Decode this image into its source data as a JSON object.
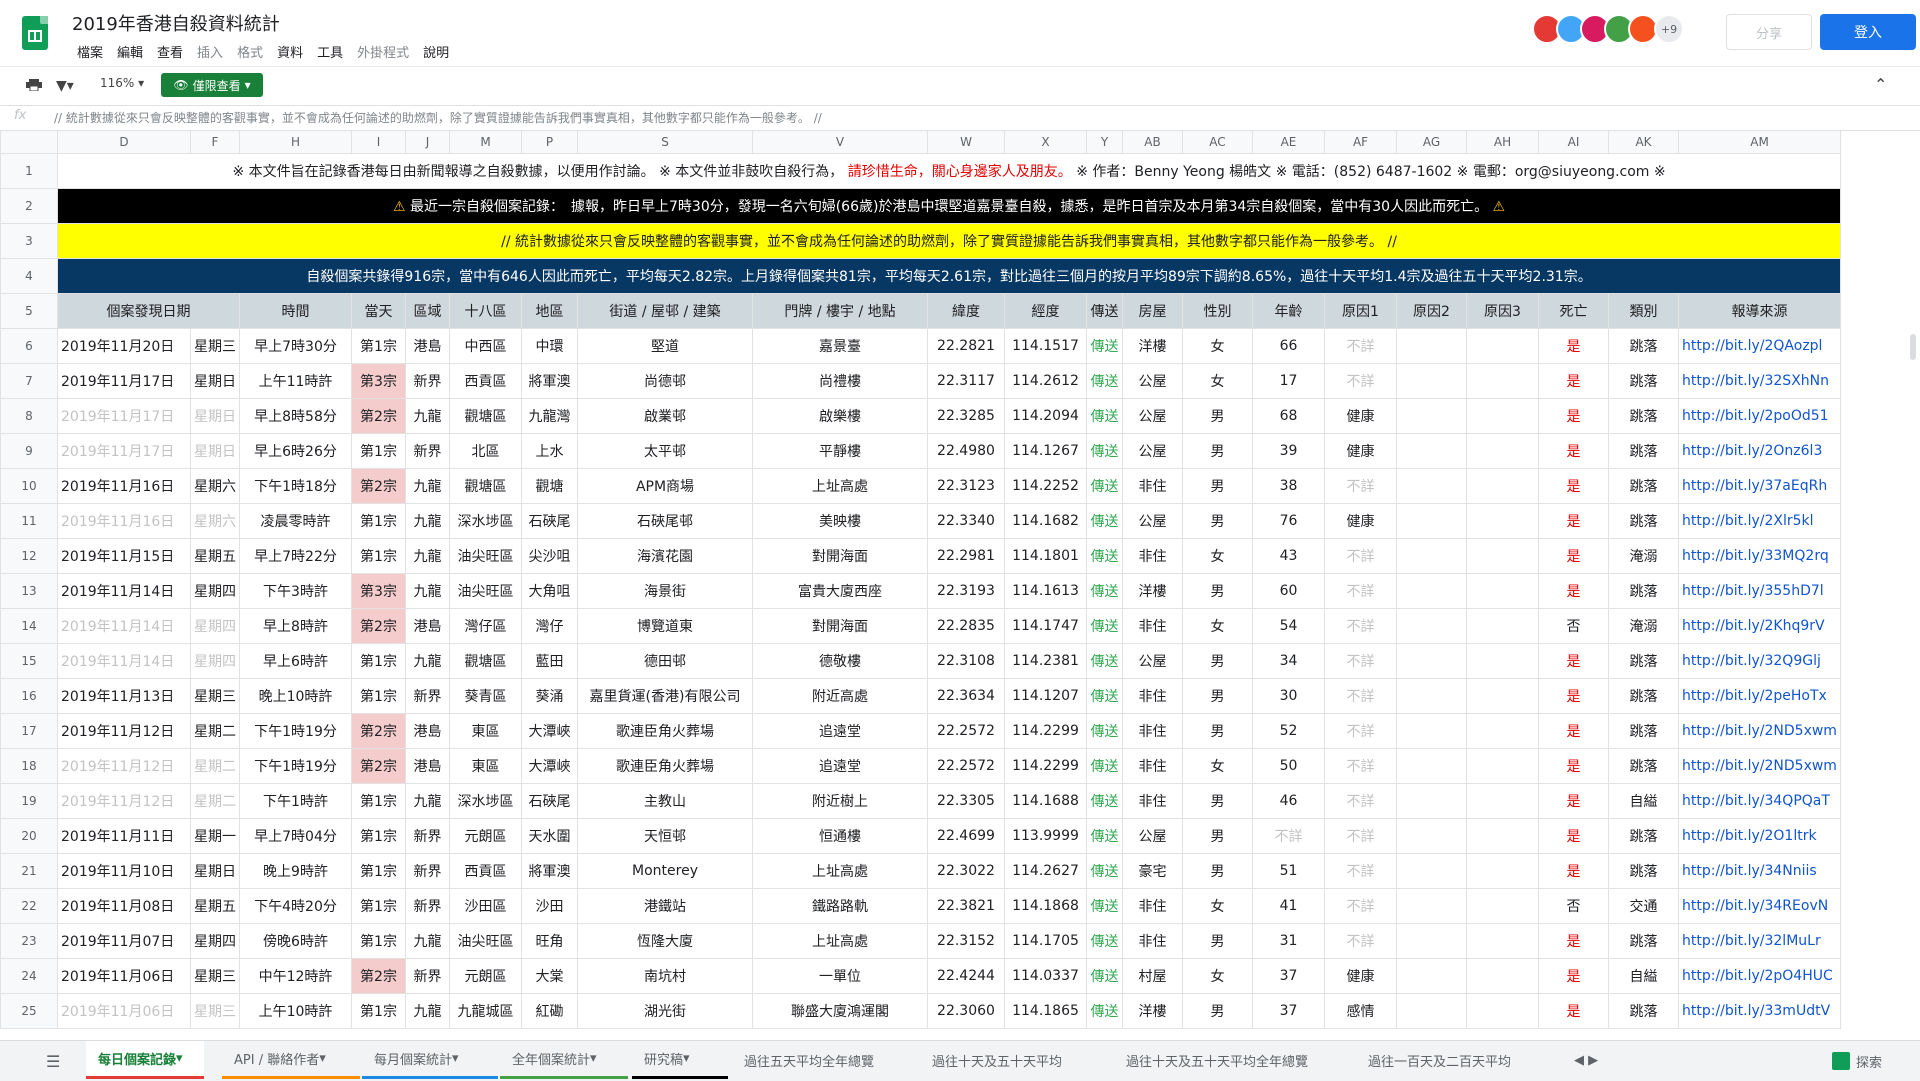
{
  "doc": {
    "title": "2019年香港自殺資料統計",
    "menu": [
      "檔案",
      "編輯",
      "查看",
      "插入",
      "格式",
      "資料",
      "工具",
      "外掛程式",
      "說明"
    ],
    "menu_disabled": [
      false,
      false,
      false,
      true,
      true,
      false,
      false,
      true,
      false
    ],
    "more_users": "+9",
    "share_label": "分享",
    "login_label": "登入"
  },
  "toolbar": {
    "zoom": "116%",
    "view_only": "僅限查看"
  },
  "formula": {
    "text": "// 統計數據從來只會反映整體的客觀事實，並不會成為任何論述的助燃劑，除了實質證據能告訴我們事實真相，其他數字都只能作為一般參考。 //"
  },
  "columns": [
    "D",
    "F",
    "H",
    "I",
    "J",
    "M",
    "P",
    "S",
    "V",
    "W",
    "X",
    "Y",
    "AB",
    "AC",
    "AE",
    "AF",
    "AG",
    "AH",
    "AI",
    "AK",
    "AM"
  ],
  "banners": {
    "b1a": "※ 本文件旨在記錄香港每日由新聞報導之自殺數據，以便用作討論。 ※ 本文件並非鼓吹自殺行為，",
    "b1b": "請珍惜生命，關心身邊家人及朋友。",
    "b1c": "※ 作者：Benny Yeong 楊皓文 ※ 電話：(852) 6487-1602 ※ 電郵：org@siuyeong.com ※",
    "b2": "最近一宗自殺個案記錄：　據報，昨日早上7時30分，發現一名六旬婦(66歲)於港島中環堅道嘉景臺自殺，據悉，是昨日首宗及本月第34宗自殺個案，當中有30人因此而死亡。",
    "b3": "// 統計數據從來只會反映整體的客觀事實，並不會成為任何論述的助燃劑，除了實質證據能告訴我們事實真相，其他數字都只能作為一般參考。 //",
    "b4": "自殺個案共錄得916宗，當中有646人因此而死亡，平均每天2.82宗。上月錄得個案共81宗，平均每天2.61宗，對比過往三個月的按月平均89宗下調約8.65%，過往十天平均1.4宗及過往五十天平均2.31宗。"
  },
  "headers": [
    "個案發現日期",
    "時間",
    "當天",
    "區域",
    "十八區",
    "地區",
    "街道 / 屋邨 / 建築",
    "門牌 / 樓宇 / 地點",
    "緯度",
    "經度",
    "傳送",
    "房屋",
    "性別",
    "年齡",
    "原因1",
    "原因2",
    "原因3",
    "死亡",
    "類別",
    "報導來源"
  ],
  "rows": [
    {
      "n": "6",
      "date": "2019年11月20日",
      "wd": "星期三",
      "time": "早上7時30分",
      "day": "第1宗",
      "reg": "港島",
      "dist": "中西區",
      "area": "中環",
      "street": "堅道",
      "place": "嘉景臺",
      "lat": "22.2821",
      "lng": "114.1517",
      "send": "傳送",
      "house": "洋樓",
      "sex": "女",
      "age": "66",
      "r1": "不詳",
      "r2": "",
      "r3": "",
      "death": "是",
      "cat": "跳落",
      "src": "http://bit.ly/2QAozpl",
      "dim": false,
      "pink": false
    },
    {
      "n": "7",
      "date": "2019年11月17日",
      "wd": "星期日",
      "time": "上午11時許",
      "day": "第3宗",
      "reg": "新界",
      "dist": "西貢區",
      "area": "將軍澳",
      "street": "尚德邨",
      "place": "尚禮樓",
      "lat": "22.3117",
      "lng": "114.2612",
      "send": "傳送",
      "house": "公屋",
      "sex": "女",
      "age": "17",
      "r1": "不詳",
      "r2": "",
      "r3": "",
      "death": "是",
      "cat": "跳落",
      "src": "http://bit.ly/32SXhNn",
      "dim": false,
      "pink": true
    },
    {
      "n": "8",
      "date": "2019年11月17日",
      "wd": "星期日",
      "time": "早上8時58分",
      "day": "第2宗",
      "reg": "九龍",
      "dist": "觀塘區",
      "area": "九龍灣",
      "street": "啟業邨",
      "place": "啟樂樓",
      "lat": "22.3285",
      "lng": "114.2094",
      "send": "傳送",
      "house": "公屋",
      "sex": "男",
      "age": "68",
      "r1": "健康",
      "r2": "",
      "r3": "",
      "death": "是",
      "cat": "跳落",
      "src": "http://bit.ly/2poOd51",
      "dim": true,
      "pink": true
    },
    {
      "n": "9",
      "date": "2019年11月17日",
      "wd": "星期日",
      "time": "早上6時26分",
      "day": "第1宗",
      "reg": "新界",
      "dist": "北區",
      "area": "上水",
      "street": "太平邨",
      "place": "平靜樓",
      "lat": "22.4980",
      "lng": "114.1267",
      "send": "傳送",
      "house": "公屋",
      "sex": "男",
      "age": "39",
      "r1": "健康",
      "r2": "",
      "r3": "",
      "death": "是",
      "cat": "跳落",
      "src": "http://bit.ly/2Onz6l3",
      "dim": true,
      "pink": false
    },
    {
      "n": "10",
      "date": "2019年11月16日",
      "wd": "星期六",
      "time": "下午1時18分",
      "day": "第2宗",
      "reg": "九龍",
      "dist": "觀塘區",
      "area": "觀塘",
      "street": "APM商場",
      "place": "上址高處",
      "lat": "22.3123",
      "lng": "114.2252",
      "send": "傳送",
      "house": "非住",
      "sex": "男",
      "age": "38",
      "r1": "不詳",
      "r2": "",
      "r3": "",
      "death": "是",
      "cat": "跳落",
      "src": "http://bit.ly/37aEqRh",
      "dim": false,
      "pink": true
    },
    {
      "n": "11",
      "date": "2019年11月16日",
      "wd": "星期六",
      "time": "凌晨零時許",
      "day": "第1宗",
      "reg": "九龍",
      "dist": "深水埗區",
      "area": "石硤尾",
      "street": "石硤尾邨",
      "place": "美映樓",
      "lat": "22.3340",
      "lng": "114.1682",
      "send": "傳送",
      "house": "公屋",
      "sex": "男",
      "age": "76",
      "r1": "健康",
      "r2": "",
      "r3": "",
      "death": "是",
      "cat": "跳落",
      "src": "http://bit.ly/2Xlr5kl",
      "dim": true,
      "pink": false
    },
    {
      "n": "12",
      "date": "2019年11月15日",
      "wd": "星期五",
      "time": "早上7時22分",
      "day": "第1宗",
      "reg": "九龍",
      "dist": "油尖旺區",
      "area": "尖沙咀",
      "street": "海濱花園",
      "place": "對開海面",
      "lat": "22.2981",
      "lng": "114.1801",
      "send": "傳送",
      "house": "非住",
      "sex": "女",
      "age": "43",
      "r1": "不詳",
      "r2": "",
      "r3": "",
      "death": "是",
      "cat": "淹溺",
      "src": "http://bit.ly/33MQ2rq",
      "dim": false,
      "pink": false
    },
    {
      "n": "13",
      "date": "2019年11月14日",
      "wd": "星期四",
      "time": "下午3時許",
      "day": "第3宗",
      "reg": "九龍",
      "dist": "油尖旺區",
      "area": "大角咀",
      "street": "海景街",
      "place": "富貴大廈西座",
      "lat": "22.3193",
      "lng": "114.1613",
      "send": "傳送",
      "house": "洋樓",
      "sex": "男",
      "age": "60",
      "r1": "不詳",
      "r2": "",
      "r3": "",
      "death": "是",
      "cat": "跳落",
      "src": "http://bit.ly/355hD7l",
      "dim": false,
      "pink": true
    },
    {
      "n": "14",
      "date": "2019年11月14日",
      "wd": "星期四",
      "time": "早上8時許",
      "day": "第2宗",
      "reg": "港島",
      "dist": "灣仔區",
      "area": "灣仔",
      "street": "博覽道東",
      "place": "對開海面",
      "lat": "22.2835",
      "lng": "114.1747",
      "send": "傳送",
      "house": "非住",
      "sex": "女",
      "age": "54",
      "r1": "不詳",
      "r2": "",
      "r3": "",
      "death": "否",
      "cat": "淹溺",
      "src": "http://bit.ly/2Khq9rV",
      "dim": true,
      "pink": true
    },
    {
      "n": "15",
      "date": "2019年11月14日",
      "wd": "星期四",
      "time": "早上6時許",
      "day": "第1宗",
      "reg": "九龍",
      "dist": "觀塘區",
      "area": "藍田",
      "street": "德田邨",
      "place": "德敬樓",
      "lat": "22.3108",
      "lng": "114.2381",
      "send": "傳送",
      "house": "公屋",
      "sex": "男",
      "age": "34",
      "r1": "不詳",
      "r2": "",
      "r3": "",
      "death": "是",
      "cat": "跳落",
      "src": "http://bit.ly/32Q9Glj",
      "dim": true,
      "pink": false
    },
    {
      "n": "16",
      "date": "2019年11月13日",
      "wd": "星期三",
      "time": "晚上10時許",
      "day": "第1宗",
      "reg": "新界",
      "dist": "葵青區",
      "area": "葵涌",
      "street": "嘉里貨運(香港)有限公司",
      "place": "附近高處",
      "lat": "22.3634",
      "lng": "114.1207",
      "send": "傳送",
      "house": "非住",
      "sex": "男",
      "age": "30",
      "r1": "不詳",
      "r2": "",
      "r3": "",
      "death": "是",
      "cat": "跳落",
      "src": "http://bit.ly/2peHoTx",
      "dim": false,
      "pink": false
    },
    {
      "n": "17",
      "date": "2019年11月12日",
      "wd": "星期二",
      "time": "下午1時19分",
      "day": "第2宗",
      "reg": "港島",
      "dist": "東區",
      "area": "大潭峽",
      "street": "歌連臣角火葬場",
      "place": "追遠堂",
      "lat": "22.2572",
      "lng": "114.2299",
      "send": "傳送",
      "house": "非住",
      "sex": "男",
      "age": "52",
      "r1": "不詳",
      "r2": "",
      "r3": "",
      "death": "是",
      "cat": "跳落",
      "src": "http://bit.ly/2ND5xwm",
      "dim": false,
      "pink": true
    },
    {
      "n": "18",
      "date": "2019年11月12日",
      "wd": "星期二",
      "time": "下午1時19分",
      "day": "第2宗",
      "reg": "港島",
      "dist": "東區",
      "area": "大潭峽",
      "street": "歌連臣角火葬場",
      "place": "追遠堂",
      "lat": "22.2572",
      "lng": "114.2299",
      "send": "傳送",
      "house": "非住",
      "sex": "女",
      "age": "50",
      "r1": "不詳",
      "r2": "",
      "r3": "",
      "death": "是",
      "cat": "跳落",
      "src": "http://bit.ly/2ND5xwm",
      "dim": true,
      "pink": true
    },
    {
      "n": "19",
      "date": "2019年11月12日",
      "wd": "星期二",
      "time": "下午1時許",
      "day": "第1宗",
      "reg": "九龍",
      "dist": "深水埗區",
      "area": "石硤尾",
      "street": "主教山",
      "place": "附近樹上",
      "lat": "22.3305",
      "lng": "114.1688",
      "send": "傳送",
      "house": "非住",
      "sex": "男",
      "age": "46",
      "r1": "不詳",
      "r2": "",
      "r3": "",
      "death": "是",
      "cat": "自縊",
      "src": "http://bit.ly/34QPQaT",
      "dim": true,
      "pink": false
    },
    {
      "n": "20",
      "date": "2019年11月11日",
      "wd": "星期一",
      "time": "早上7時04分",
      "day": "第1宗",
      "reg": "新界",
      "dist": "元朗區",
      "area": "天水圍",
      "street": "天恒邨",
      "place": "恒通樓",
      "lat": "22.4699",
      "lng": "113.9999",
      "send": "傳送",
      "house": "公屋",
      "sex": "男",
      "age": "不詳",
      "r1": "不詳",
      "r2": "",
      "r3": "",
      "death": "是",
      "cat": "跳落",
      "src": "http://bit.ly/2O1ltrk",
      "dim": false,
      "pink": false
    },
    {
      "n": "21",
      "date": "2019年11月10日",
      "wd": "星期日",
      "time": "晚上9時許",
      "day": "第1宗",
      "reg": "新界",
      "dist": "西貢區",
      "area": "將軍澳",
      "street": "Monterey",
      "place": "上址高處",
      "lat": "22.3022",
      "lng": "114.2627",
      "send": "傳送",
      "house": "豪宅",
      "sex": "男",
      "age": "51",
      "r1": "不詳",
      "r2": "",
      "r3": "",
      "death": "是",
      "cat": "跳落",
      "src": "http://bit.ly/34Nniis",
      "dim": false,
      "pink": false
    },
    {
      "n": "22",
      "date": "2019年11月08日",
      "wd": "星期五",
      "time": "下午4時20分",
      "day": "第1宗",
      "reg": "新界",
      "dist": "沙田區",
      "area": "沙田",
      "street": "港鐵站",
      "place": "鐵路路軌",
      "lat": "22.3821",
      "lng": "114.1868",
      "send": "傳送",
      "house": "非住",
      "sex": "女",
      "age": "41",
      "r1": "不詳",
      "r2": "",
      "r3": "",
      "death": "否",
      "cat": "交通",
      "src": "http://bit.ly/34REovN",
      "dim": false,
      "pink": false
    },
    {
      "n": "23",
      "date": "2019年11月07日",
      "wd": "星期四",
      "time": "傍晚6時許",
      "day": "第1宗",
      "reg": "九龍",
      "dist": "油尖旺區",
      "area": "旺角",
      "street": "恆隆大廈",
      "place": "上址高處",
      "lat": "22.3152",
      "lng": "114.1705",
      "send": "傳送",
      "house": "非住",
      "sex": "男",
      "age": "31",
      "r1": "不詳",
      "r2": "",
      "r3": "",
      "death": "是",
      "cat": "跳落",
      "src": "http://bit.ly/32lMuLr",
      "dim": false,
      "pink": false
    },
    {
      "n": "24",
      "date": "2019年11月06日",
      "wd": "星期三",
      "time": "中午12時許",
      "day": "第2宗",
      "reg": "新界",
      "dist": "元朗區",
      "area": "大棠",
      "street": "南坑村",
      "place": "一單位",
      "lat": "22.4244",
      "lng": "114.0337",
      "send": "傳送",
      "house": "村屋",
      "sex": "女",
      "age": "37",
      "r1": "健康",
      "r2": "",
      "r3": "",
      "death": "是",
      "cat": "自縊",
      "src": "http://bit.ly/2pO4HUC",
      "dim": false,
      "pink": true
    },
    {
      "n": "25",
      "date": "2019年11月06日",
      "wd": "星期三",
      "time": "上午10時許",
      "day": "第1宗",
      "reg": "九龍",
      "dist": "九龍城區",
      "area": "紅磡",
      "street": "湖光街",
      "place": "聯盛大廈鴻運閣",
      "lat": "22.3060",
      "lng": "114.1865",
      "send": "傳送",
      "house": "洋樓",
      "sex": "男",
      "age": "37",
      "r1": "感情",
      "r2": "",
      "r3": "",
      "death": "是",
      "cat": "跳落",
      "src": "http://bit.ly/33mUdtV",
      "dim": true,
      "pink": false
    }
  ],
  "tabs": [
    "每日個案記錄",
    "API / 聯絡作者",
    "每月個案統計",
    "全年個案統計",
    "研究稿",
    "過往五天平均全年總覽",
    "過往十天及五十天平均",
    "過往十天及五十天平均全年總覽",
    "過往一百天及二百天平均"
  ],
  "explore_label": "探索",
  "colors": {
    "accent_green": "#188038",
    "login_blue": "#1a73e8",
    "banner_black": "#000000",
    "banner_yellow": "#ffff00",
    "banner_navy": "#073763",
    "header_grey": "#cfd8dc",
    "death_red": "#e60000"
  }
}
